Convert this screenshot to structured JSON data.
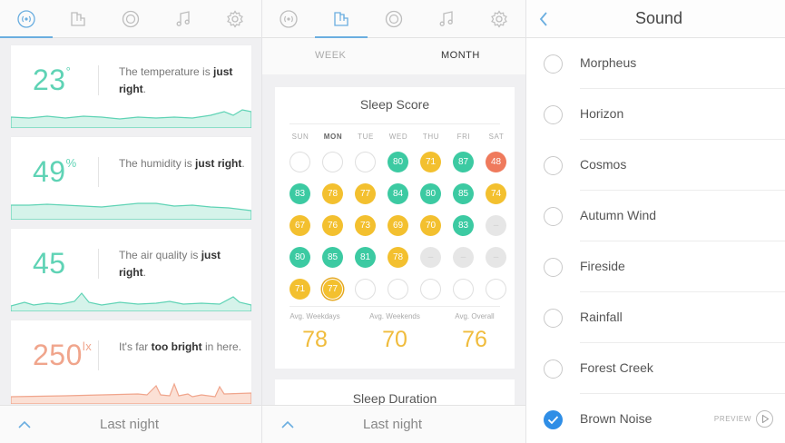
{
  "colors": {
    "accent_blue": "#6aaee0",
    "teal": "#3ccaa2",
    "yellow": "#f3c02f",
    "orange_red": "#ef7a5c",
    "light_bright": "#f0a58c",
    "check_blue": "#2f8ee6"
  },
  "tab_icons": [
    "signal-icon",
    "chart-icon",
    "light-icon",
    "music-icon",
    "settings-icon"
  ],
  "environment": {
    "cards": [
      {
        "value": "23",
        "unit": "°",
        "color": "#5fd3b5",
        "desc_pre": "The temperature is ",
        "desc_bold": "just right",
        "desc_post": "."
      },
      {
        "value": "49",
        "unit": "%",
        "color": "#5fd3b5",
        "desc_pre": "The humidity is ",
        "desc_bold": "just right",
        "desc_post": "."
      },
      {
        "value": "45",
        "unit": "",
        "color": "#5fd3b5",
        "desc_pre": "The air quality is ",
        "desc_bold": "just right",
        "desc_post": "."
      },
      {
        "value": "250",
        "unit": "lx",
        "color": "#f0a58c",
        "desc_pre": "It's far ",
        "desc_bold": "too bright",
        "desc_post": " in here."
      }
    ],
    "bottom_label": "Last night"
  },
  "sleep": {
    "subtabs": {
      "week": "WEEK",
      "month": "MONTH",
      "active": "month"
    },
    "score_title": "Sleep Score",
    "days": [
      "SUN",
      "MON",
      "TUE",
      "WED",
      "THU",
      "FRI",
      "SAT"
    ],
    "grid": [
      [
        null,
        null,
        null,
        {
          "v": "80",
          "c": "green"
        },
        {
          "v": "71",
          "c": "yellow"
        },
        {
          "v": "87",
          "c": "green"
        },
        {
          "v": "48",
          "c": "red"
        }
      ],
      [
        {
          "v": "83",
          "c": "green"
        },
        {
          "v": "78",
          "c": "yellow"
        },
        {
          "v": "77",
          "c": "yellow"
        },
        {
          "v": "84",
          "c": "green"
        },
        {
          "v": "80",
          "c": "green"
        },
        {
          "v": "85",
          "c": "green"
        },
        {
          "v": "74",
          "c": "yellow"
        }
      ],
      [
        {
          "v": "67",
          "c": "yellow"
        },
        {
          "v": "76",
          "c": "yellow"
        },
        {
          "v": "73",
          "c": "yellow"
        },
        {
          "v": "69",
          "c": "yellow"
        },
        {
          "v": "70",
          "c": "yellow"
        },
        {
          "v": "83",
          "c": "green"
        },
        {
          "v": "–",
          "c": "grey"
        }
      ],
      [
        {
          "v": "80",
          "c": "green"
        },
        {
          "v": "85",
          "c": "green"
        },
        {
          "v": "81",
          "c": "green"
        },
        {
          "v": "78",
          "c": "yellow"
        },
        {
          "v": "–",
          "c": "grey"
        },
        {
          "v": "–",
          "c": "grey"
        },
        {
          "v": "–",
          "c": "grey"
        }
      ],
      [
        {
          "v": "71",
          "c": "yellow"
        },
        {
          "v": "77",
          "c": "yellow",
          "today": true
        },
        null,
        null,
        null,
        null,
        null
      ]
    ],
    "averages": [
      {
        "label": "Avg. Weekdays",
        "value": "78"
      },
      {
        "label": "Avg. Weekends",
        "value": "70"
      },
      {
        "label": "Avg. Overall",
        "value": "76"
      }
    ],
    "duration_title": "Sleep Duration",
    "bottom_label": "Last night"
  },
  "sound": {
    "title": "Sound",
    "items": [
      {
        "name": "Morpheus",
        "checked": false
      },
      {
        "name": "Horizon",
        "checked": false
      },
      {
        "name": "Cosmos",
        "checked": false
      },
      {
        "name": "Autumn Wind",
        "checked": false
      },
      {
        "name": "Fireside",
        "checked": false
      },
      {
        "name": "Rainfall",
        "checked": false
      },
      {
        "name": "Forest Creek",
        "checked": false
      },
      {
        "name": "Brown Noise",
        "checked": true
      }
    ],
    "preview_label": "PREVIEW"
  }
}
